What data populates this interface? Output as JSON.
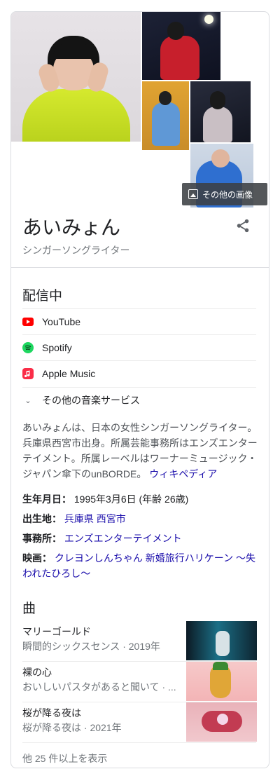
{
  "more_images_label": "その他の画像",
  "entity": {
    "title": "あいみょん",
    "subtitle": "シンガーソングライター"
  },
  "streaming": {
    "heading": "配信中",
    "services": [
      {
        "label": "YouTube",
        "icon": "youtube-icon",
        "color": "#ff0000"
      },
      {
        "label": "Spotify",
        "icon": "spotify-icon",
        "color": "#1ed760"
      },
      {
        "label": "Apple Music",
        "icon": "apple-music-icon",
        "color": "#fa2d48"
      }
    ],
    "more_label": "その他の音楽サービス"
  },
  "description": {
    "text": "あいみょんは、日本の女性シンガーソングライター。兵庫県西宮市出身。所属芸能事務所はエンズエンターテイメント。所属レーベルはワーナーミュージック・ジャパン傘下のunBORDE。",
    "source": "ウィキペディア"
  },
  "facts": {
    "born_label": "生年月日：",
    "born_value": "1995年3月6日 (年齢 26歳)",
    "birthplace_label": "出生地：",
    "birthplace_value": "兵庫県 西宮市",
    "agency_label": "事務所：",
    "agency_value": "エンズエンターテイメント",
    "film_label": "映画：",
    "film_value": "クレヨンしんちゃん 新婚旅行ハリケーン ～失われたひろし～"
  },
  "songs": {
    "heading": "曲",
    "items": [
      {
        "name": "マリーゴールド",
        "meta": "瞬間的シックスセンス · 2019年"
      },
      {
        "name": "裸の心",
        "meta": "おいしいパスタがあると聞いて · ..."
      },
      {
        "name": "桜が降る夜は",
        "meta": "桜が降る夜は · 2021年"
      }
    ],
    "show_more": "他 25 件以上を表示"
  },
  "colors": {
    "link": "#1a0dab",
    "secondary_text": "#70757a",
    "divider": "#dadce0"
  }
}
